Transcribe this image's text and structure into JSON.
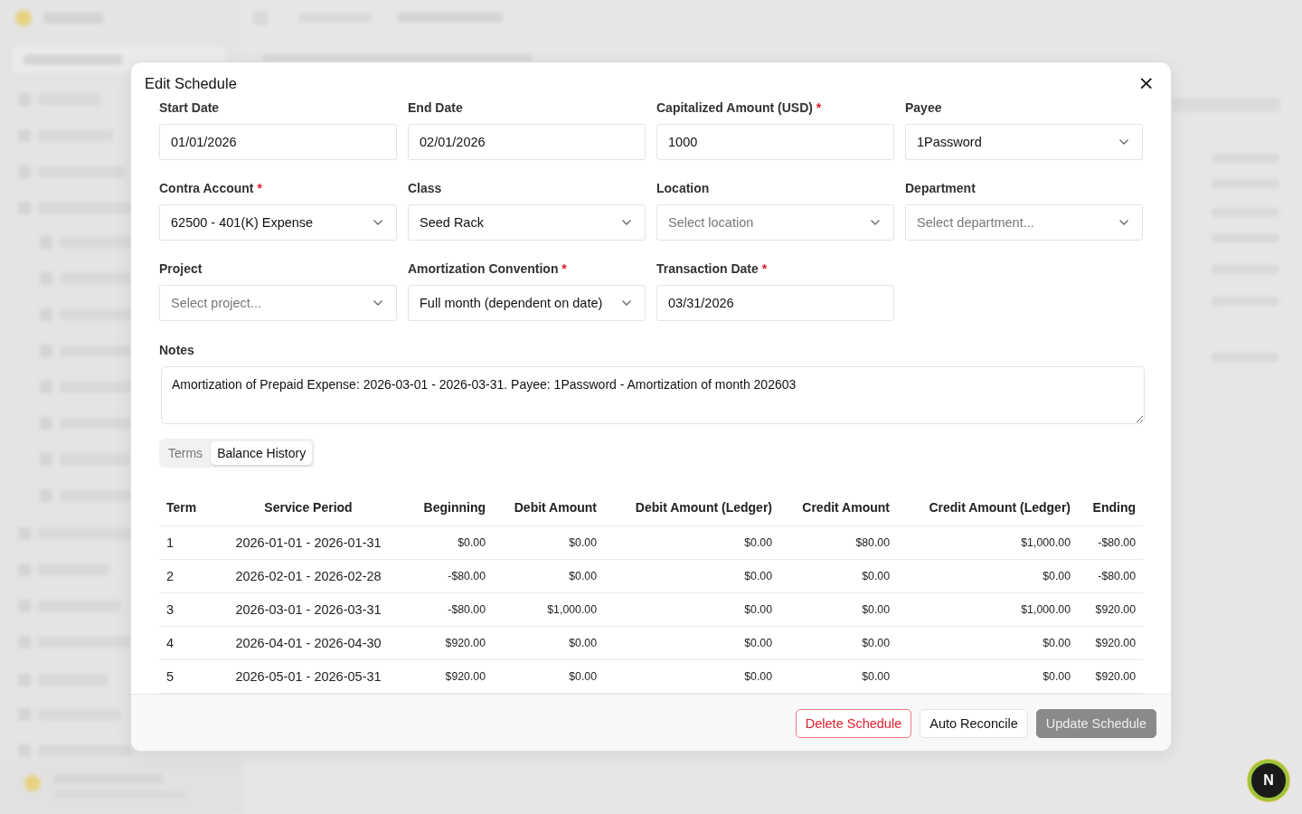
{
  "dialog": {
    "title": "Edit Schedule",
    "close": "×"
  },
  "fields": [
    {
      "kind": "text",
      "label": "Start Date",
      "value": "01/01/2026"
    },
    {
      "kind": "text",
      "label": "End Date",
      "value": "02/01/2026"
    },
    {
      "kind": "text",
      "label": "Capitalized Amount (USD)",
      "required_mark": "*",
      "value": "1000"
    },
    {
      "kind": "select",
      "label": "Payee",
      "value": "1Password"
    },
    {
      "kind": "select",
      "label": "Contra Account",
      "required_mark": "*",
      "value": "62500 - 401(K) Expense"
    },
    {
      "kind": "select",
      "label": "Class",
      "value": "Seed Rack"
    },
    {
      "kind": "select",
      "label": "Location",
      "placeholder": "Select location"
    },
    {
      "kind": "select",
      "label": "Department",
      "placeholder": "Select department..."
    },
    {
      "kind": "select",
      "label": "Project",
      "placeholder": "Select project..."
    },
    {
      "kind": "select",
      "label": "Amortization Convention",
      "required_mark": "*",
      "value": "Full month (dependent on date)"
    },
    {
      "kind": "text",
      "label": "Transaction Date",
      "required_mark": "*",
      "value": "03/31/2026"
    }
  ],
  "notes": {
    "label": "Notes",
    "value": "Amortization of Prepaid Expense: 2026-03-01 - 2026-03-31. Payee: 1Password - Amortization of month 202603"
  },
  "tabs": [
    {
      "label": "Terms",
      "selected": false
    },
    {
      "label": "Balance History",
      "selected": true
    }
  ],
  "table": {
    "columns": [
      "Term",
      "Service Period",
      "Beginning",
      "Debit Amount",
      "Debit Amount (Ledger)",
      "Credit Amount",
      "Credit Amount (Ledger)",
      "Ending"
    ],
    "rows": [
      [
        "1",
        "2026-01-01 - 2026-01-31",
        "$0.00",
        "$0.00",
        "$0.00",
        "$80.00",
        "$1,000.00",
        "-$80.00"
      ],
      [
        "2",
        "2026-02-01 - 2026-02-28",
        "-$80.00",
        "$0.00",
        "$0.00",
        "$0.00",
        "$0.00",
        "-$80.00"
      ],
      [
        "3",
        "2026-03-01 - 2026-03-31",
        "-$80.00",
        "$1,000.00",
        "$0.00",
        "$0.00",
        "$1,000.00",
        "$920.00"
      ],
      [
        "4",
        "2026-04-01 - 2026-04-30",
        "$920.00",
        "$0.00",
        "$0.00",
        "$0.00",
        "$0.00",
        "$920.00"
      ],
      [
        "5",
        "2026-05-01 - 2026-05-31",
        "$920.00",
        "$0.00",
        "$0.00",
        "$0.00",
        "$0.00",
        "$920.00"
      ]
    ]
  },
  "buttons": [
    {
      "kind": "danger",
      "label": "Delete Schedule",
      "disabled": false
    },
    {
      "kind": "outline",
      "label": "Auto Reconcile",
      "disabled": false
    },
    {
      "kind": "primary",
      "label": "Update Schedule",
      "disabled": true
    }
  ],
  "dev_badge": "N"
}
